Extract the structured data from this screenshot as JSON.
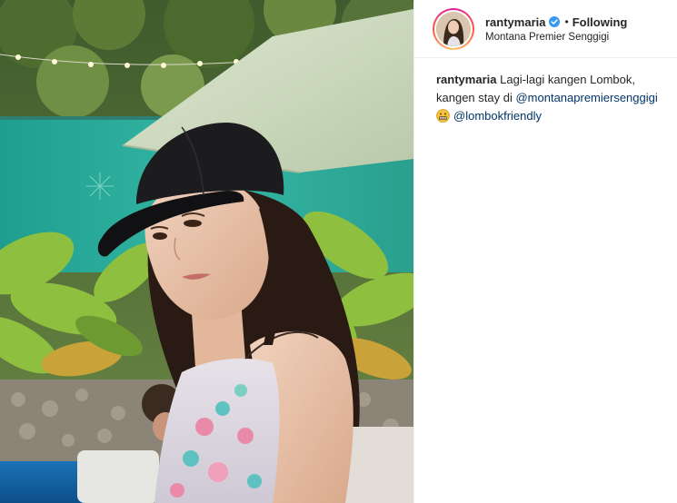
{
  "post": {
    "author": {
      "username": "rantymaria",
      "verified": true,
      "follow_status": "Following",
      "separator": "•",
      "location": "Montana Premier Senggigi"
    },
    "caption": {
      "username": "rantymaria",
      "text_part1": "Lagi-lagi kangen Lombok,",
      "text_part2": "kangen stay di",
      "mention1": "@montanapremiersenggigi",
      "emoji": "grimacing-face-emoji",
      "mention2": "@lombokfriendly"
    }
  },
  "colors": {
    "text": "#262626",
    "mention": "#003569",
    "verified_badge": "#3897f0",
    "divider": "#efefef"
  }
}
